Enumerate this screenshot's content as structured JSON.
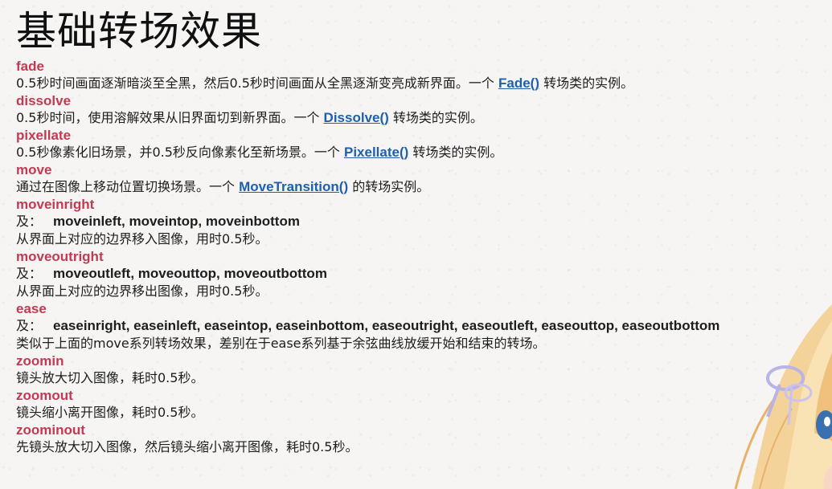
{
  "title": "基础转场效果",
  "entries": [
    {
      "name": "fade",
      "before": "0.5秒时间画面逐渐暗淡至全黑，然后0.5秒时间画面从全黑逐渐变亮成新界面。一个 ",
      "link": "Fade()",
      "after": " 转场类的实例。"
    },
    {
      "name": "dissolve",
      "before": "0.5秒时间，使用溶解效果从旧界面切到新界面。一个 ",
      "link": "Dissolve()",
      "after": " 转场类的实例。"
    },
    {
      "name": "pixellate",
      "before": "0.5秒像素化旧场景，并0.5秒反向像素化至新场景。一个 ",
      "link": "Pixellate()",
      "after": " 转场类的实例。"
    },
    {
      "name": "move",
      "before": "通过在图像上移动位置切换场景。一个 ",
      "link": "MoveTransition()",
      "after": " 的转场实例。"
    },
    {
      "name": "moveinright",
      "alias_prefix": "及：",
      "aliases": "moveinleft, moveintop, moveinbottom",
      "desc": "从界面上对应的边界移入图像，用时0.5秒。"
    },
    {
      "name": "moveoutright",
      "alias_prefix": "及：",
      "aliases": "moveoutleft, moveouttop, moveoutbottom",
      "desc": "从界面上对应的边界移出图像，用时0.5秒。"
    },
    {
      "name": "ease",
      "alias_prefix": "及：",
      "aliases": "easeinright, easeinleft, easeintop, easeinbottom, easeoutright, easeoutleft, easeouttop, easeoutbottom",
      "desc": "类似于上面的move系列转场效果，差别在于ease系列基于余弦曲线放缓开始和结束的转场。"
    },
    {
      "name": "zoomin",
      "desc": "镜头放大切入图像，耗时0.5秒。"
    },
    {
      "name": "zoomout",
      "desc": "镜头缩小离开图像，耗时0.5秒。"
    },
    {
      "name": "zoominout",
      "desc": "先镜头放大切入图像，然后镜头缩小离开图像，耗时0.5秒。"
    }
  ],
  "colors": {
    "name": "#c23a52",
    "link": "#1f5fae",
    "text": "#1d1d1d"
  }
}
